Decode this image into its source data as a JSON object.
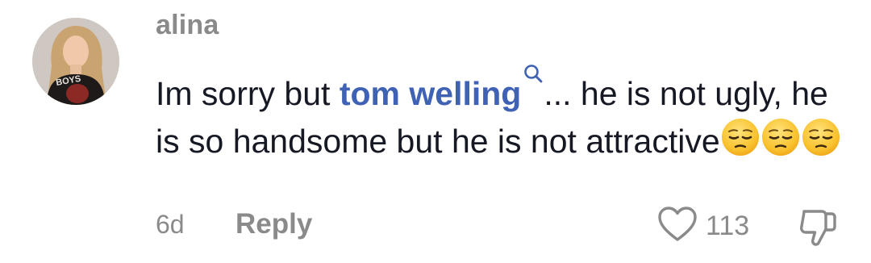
{
  "comment": {
    "username": "alina",
    "text_before": "Im sorry but ",
    "mention": "tom welling",
    "text_after": "... he is not ugly, he is so handsome but he is not attractive",
    "emojis": [
      "pensive-face",
      "pensive-face",
      "pensive-face"
    ],
    "avatar_shirt_text": "BOYS"
  },
  "footer": {
    "time": "6d",
    "reply_label": "Reply",
    "like_count": "113"
  },
  "colors": {
    "username": "#8a8a8a",
    "body": "#161823",
    "mention": "#3f62b5",
    "meta": "#8a8a8a"
  },
  "icons": {
    "mention": "search-icon",
    "like": "heart-outline-icon",
    "dislike": "thumbs-down-icon"
  }
}
